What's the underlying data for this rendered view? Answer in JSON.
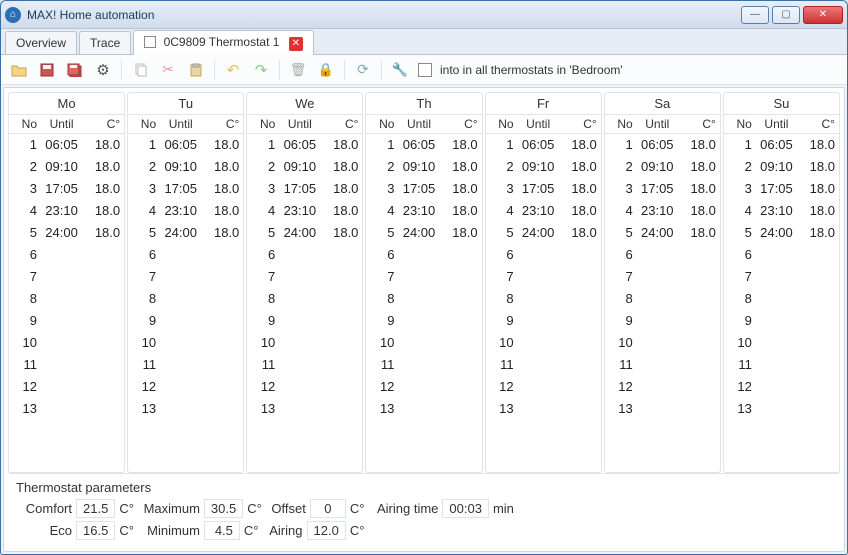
{
  "window": {
    "title": "MAX! Home automation"
  },
  "tabs": [
    {
      "label": "Overview",
      "active": false
    },
    {
      "label": "Trace",
      "active": false
    },
    {
      "label": "0C9809 Thermostat 1",
      "active": true,
      "closable": true
    }
  ],
  "toolbar": {
    "checkbox_label": "into in all thermostats in 'Bedroom'"
  },
  "schedule": {
    "col_headers": {
      "no": "No",
      "until": "Until",
      "temp": "C°"
    },
    "days": [
      "Mo",
      "Tu",
      "We",
      "Th",
      "Fr",
      "Sa",
      "Su"
    ],
    "rows_per_day": 13,
    "entries": [
      {
        "no": 1,
        "until": "06:05",
        "temp": "18.0"
      },
      {
        "no": 2,
        "until": "09:10",
        "temp": "18.0"
      },
      {
        "no": 3,
        "until": "17:05",
        "temp": "18.0"
      },
      {
        "no": 4,
        "until": "23:10",
        "temp": "18.0"
      },
      {
        "no": 5,
        "until": "24:00",
        "temp": "18.0"
      }
    ]
  },
  "params": {
    "title": "Thermostat parameters",
    "comfort_label": "Comfort",
    "comfort": "21.5",
    "eco_label": "Eco",
    "eco": "16.5",
    "maximum_label": "Maximum",
    "maximum": "30.5",
    "minimum_label": "Minimum",
    "minimum": "4.5",
    "offset_label": "Offset",
    "offset": "0",
    "airing_label": "Airing",
    "airing": "12.0",
    "airing_time_label": "Airing time",
    "airing_time": "00:03",
    "unit_c": "C°",
    "unit_min": "min"
  }
}
